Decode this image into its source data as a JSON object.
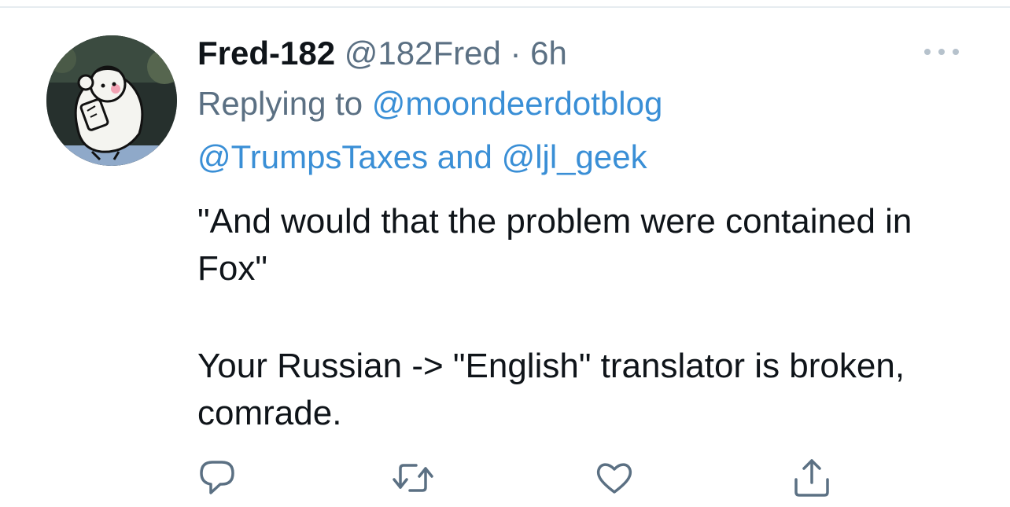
{
  "tweet": {
    "display_name": "Fred-182",
    "handle": "@182Fred",
    "separator": "·",
    "time": "6h",
    "replying_to_prefix": "Replying to ",
    "mention_1": "@moondeerdotblog",
    "mention_2": "@TrumpsTaxes",
    "and_word": " and ",
    "mention_3": "@ljl_geek",
    "body_paragraph_1": "\"And would that the problem were contained in Fox\"",
    "body_paragraph_2": "Your Russian -> \"English\" translator is broken, comrade."
  },
  "icons": {
    "more": "more-horizontal-icon",
    "reply": "reply-bubble-icon",
    "retweet": "retweet-icon",
    "like": "heart-icon",
    "share": "share-upload-icon"
  },
  "colors": {
    "text_primary": "#0f1419",
    "text_secondary": "#5b7083",
    "link": "#3a8fd6",
    "icon": "#5b7083",
    "divider": "#e6ecf0"
  }
}
